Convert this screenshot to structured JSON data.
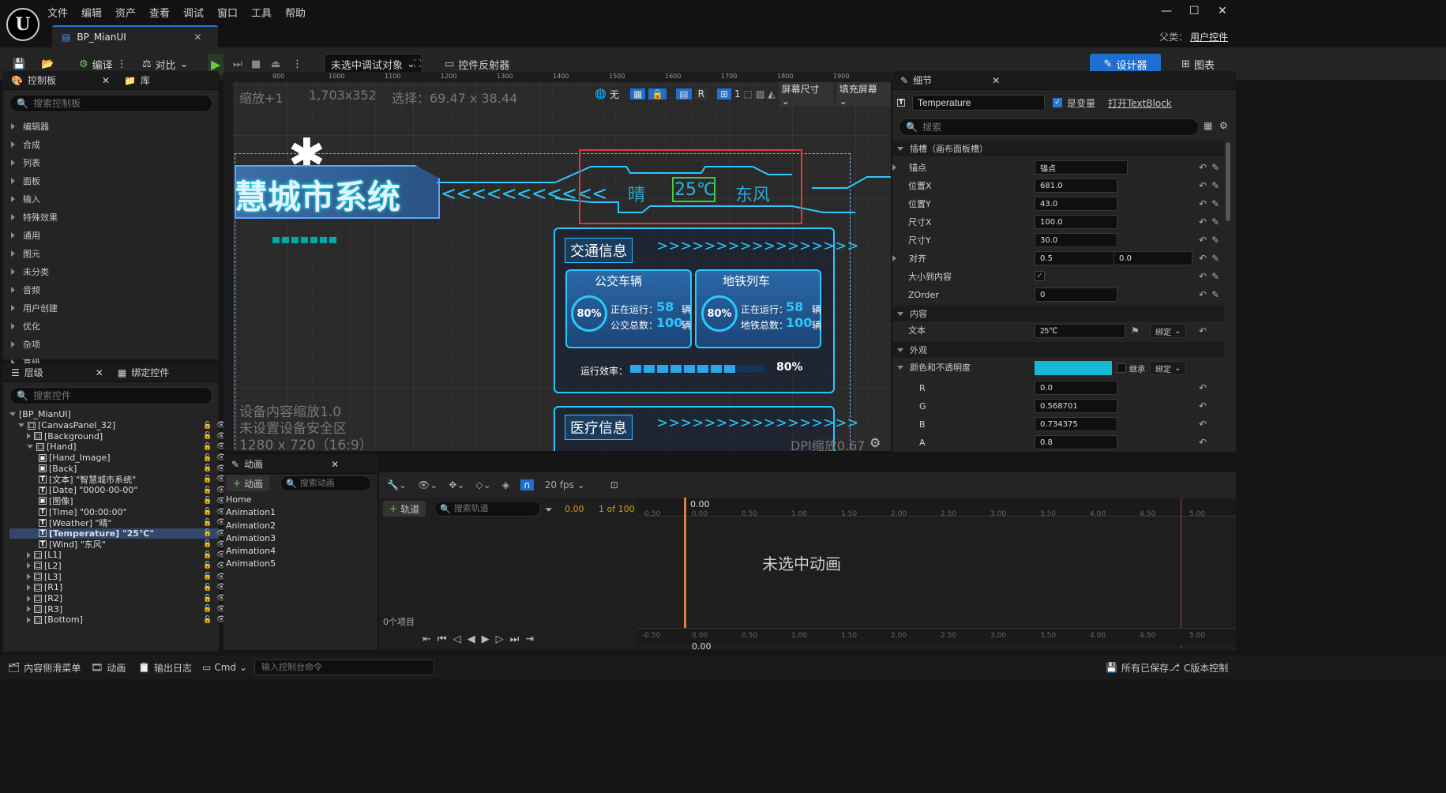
{
  "menu": [
    "文件",
    "编辑",
    "资产",
    "查看",
    "调试",
    "窗口",
    "工具",
    "帮助"
  ],
  "tab": {
    "title": "BP_MianUI"
  },
  "parent": {
    "label": "父类：",
    "value": "用户控件"
  },
  "toolbar": {
    "compile": "编译",
    "diff": "对比",
    "debug_target": "未选中调试对象",
    "reflector": "控件反射器",
    "designer": "设计器",
    "graph": "图表"
  },
  "palette": {
    "tab": "控制板",
    "library_tab": "库",
    "search_placeholder": "搜索控制板",
    "categories": [
      "编辑器",
      "合成",
      "列表",
      "面板",
      "输入",
      "特殊效果",
      "通用",
      "图元",
      "未分类",
      "音频",
      "用户创建",
      "优化",
      "杂项",
      "高级"
    ]
  },
  "hierarchy": {
    "tab": "层级",
    "bind_tab": "绑定控件",
    "search_placeholder": "搜索控件",
    "items": [
      {
        "label": "[BP_MianUI]",
        "indent": 0,
        "icon": ""
      },
      {
        "label": "[CanvasPanel_32]",
        "indent": 1,
        "icon": "□"
      },
      {
        "label": "[Background]",
        "indent": 2,
        "icon": "□"
      },
      {
        "label": "[Hand]",
        "indent": 2,
        "icon": "□"
      },
      {
        "label": "[Hand_Image]",
        "indent": 3,
        "icon": "▣"
      },
      {
        "label": "[Back]",
        "indent": 3,
        "icon": "▣"
      },
      {
        "label": "[文本] \"智慧城市系统\"",
        "indent": 3,
        "icon": "T"
      },
      {
        "label": "[Date] \"0000-00-00\"",
        "indent": 3,
        "icon": "T"
      },
      {
        "label": "[图像]",
        "indent": 3,
        "icon": "▣"
      },
      {
        "label": "[Time] \"00:00:00\"",
        "indent": 3,
        "icon": "T"
      },
      {
        "label": "[Weather] \"晴\"",
        "indent": 3,
        "icon": "T"
      },
      {
        "label": "[Temperature] \"25℃\"",
        "indent": 3,
        "icon": "T"
      },
      {
        "label": "[Wind] \"东风\"",
        "indent": 3,
        "icon": "T"
      },
      {
        "label": "[L1]",
        "indent": 2,
        "icon": "□"
      },
      {
        "label": "[L2]",
        "indent": 2,
        "icon": "□"
      },
      {
        "label": "[L3]",
        "indent": 2,
        "icon": "□"
      },
      {
        "label": "[R1]",
        "indent": 2,
        "icon": "□"
      },
      {
        "label": "[R2]",
        "indent": 2,
        "icon": "□"
      },
      {
        "label": "[R3]",
        "indent": 2,
        "icon": "□"
      },
      {
        "label": "[Bottom]",
        "indent": 2,
        "icon": "□"
      }
    ],
    "selected_label": "[Temperature] \"25℃\""
  },
  "viewport": {
    "zoom": "缩放+1",
    "resolution": "1,703x352",
    "selection": "选择：69.47 x 38.44",
    "ruler_ticks": [
      "900",
      "1000",
      "1100",
      "1200",
      "1300",
      "1400",
      "1500",
      "1600",
      "1700",
      "1800",
      "1900"
    ],
    "none_label": "无",
    "screen_size": "屏幕尺寸",
    "fill_screen": "填充屏幕",
    "r_label": "R",
    "grid_count": "1",
    "device_scale": "设备内容缩放1.0",
    "safe_zone": "未设置设备安全区",
    "res_info": "1280 x 720（16:9）",
    "dpi": "DPI缩放0.67",
    "title_text": "慧城市系统",
    "chevrons_left": "<<<<<<<<<<<",
    "weather": "晴",
    "temperature": "25℃",
    "wind": "东风",
    "traffic": {
      "title": "交通信息",
      "arrows": ">>>>>>>>>>>>>>>>>",
      "bus": "公交车辆",
      "metro": "地铁列车",
      "running": "正在运行：",
      "bus_total": "公交总数：",
      "metro_total": "地铁总数：",
      "running_count": "58",
      "total_count": "100",
      "unit": "辆",
      "percent": "80%",
      "efficiency": "运行效率：",
      "efficiency_value": "80%"
    },
    "medical": {
      "title": "医疗信息",
      "arrows": ">>>>>>>>>>>>>>>>>"
    }
  },
  "details": {
    "tab": "细节",
    "name": "Temperature",
    "is_variable": "是变量",
    "open_link": "打开TextBlock",
    "search_placeholder": "搜索",
    "slot_section": "插槽（画布面板槽）",
    "rows": [
      {
        "label": "锚点",
        "value": "锚点"
      },
      {
        "label": "位置X",
        "value": "681.0"
      },
      {
        "label": "位置Y",
        "value": "43.0"
      },
      {
        "label": "尺寸X",
        "value": "100.0"
      },
      {
        "label": "尺寸Y",
        "value": "30.0"
      },
      {
        "label": "对齐",
        "value": "0.5",
        "value2": "0.0"
      },
      {
        "label": "大小到内容",
        "value": ""
      },
      {
        "label": "ZOrder",
        "value": "0"
      }
    ],
    "content_section": "内容",
    "text_label": "文本",
    "text_value": "25℃",
    "bind": "绑定",
    "appearance_section": "外观",
    "color_label": "颜色和不透明度",
    "inherit": "继承",
    "color_rows": [
      {
        "label": "R",
        "value": "0.0"
      },
      {
        "label": "G",
        "value": "0.568701"
      },
      {
        "label": "B",
        "value": "0.734375"
      },
      {
        "label": "A",
        "value": "0.8"
      }
    ],
    "swatch_color": "#17b8d6"
  },
  "animation": {
    "tab": "动画",
    "add": "动画",
    "search_placeholder": "搜索动画",
    "items": [
      "Home",
      "Animation1",
      "Animation2",
      "Animation3",
      "Animation4",
      "Animation5"
    ]
  },
  "timeline": {
    "fps": "20 fps",
    "track": "轨道",
    "search_placeholder": "搜索轨道",
    "time": "0.00",
    "frame": "1 of 100",
    "empty": "未选中动画",
    "count": "0个项目",
    "playhead": "0.00",
    "ticks": [
      "-0.50",
      "0.00",
      "0.50",
      "1.00",
      "1.50",
      "2.00",
      "2.50",
      "3.00",
      "3.50",
      "4.00",
      "4.50",
      "5.00"
    ]
  },
  "status": {
    "drawer": "内容侧滑菜单",
    "anim": "动画",
    "log": "输出日志",
    "cmd": "Cmd",
    "cmd_placeholder": "输入控制台命令",
    "saved": "所有已保存",
    "source": "C版本控制"
  },
  "colors": {
    "accent": "#1f6fd0",
    "neon": "#2cc6ff",
    "selection": "#32476a",
    "highlight_box": "#e23a3a"
  }
}
